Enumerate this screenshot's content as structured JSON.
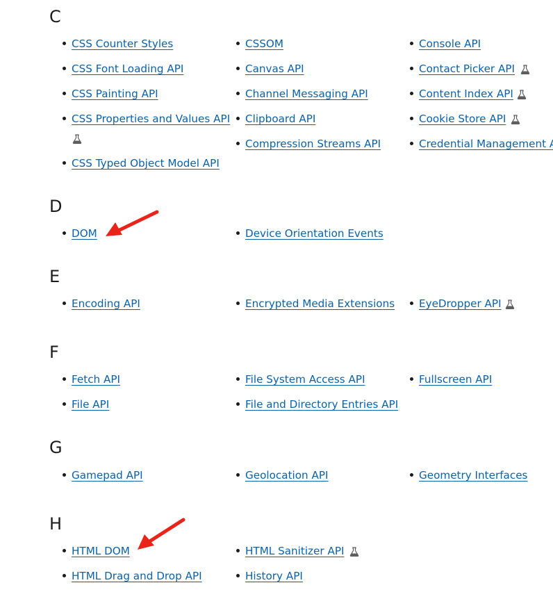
{
  "sections": [
    {
      "letter": "C",
      "items": [
        {
          "label": "CSS Counter Styles",
          "experimental": false
        },
        {
          "label": "CSS Font Loading API",
          "experimental": false
        },
        {
          "label": "CSS Painting API",
          "experimental": false
        },
        {
          "label": "CSS Properties and Values API",
          "experimental": true
        },
        {
          "label": "CSS Typed Object Model API",
          "experimental": false
        },
        {
          "label": "CSSOM",
          "experimental": false
        },
        {
          "label": "Canvas API",
          "experimental": false
        },
        {
          "label": "Channel Messaging API",
          "experimental": false
        },
        {
          "label": "Clipboard API",
          "experimental": false
        },
        {
          "label": "Compression Streams API",
          "experimental": false
        },
        {
          "label": "Console API",
          "experimental": false
        },
        {
          "label": "Contact Picker API",
          "experimental": true
        },
        {
          "label": "Content Index API",
          "experimental": true
        },
        {
          "label": "Cookie Store API",
          "experimental": true
        },
        {
          "label": "Credential Management API",
          "experimental": false
        }
      ]
    },
    {
      "letter": "D",
      "items": [
        {
          "label": "DOM",
          "experimental": false
        },
        {
          "label": "Device Orientation Events",
          "experimental": false
        }
      ]
    },
    {
      "letter": "E",
      "items": [
        {
          "label": "Encoding API",
          "experimental": false
        },
        {
          "label": "Encrypted Media Extensions",
          "experimental": false
        },
        {
          "label": "EyeDropper API",
          "experimental": true
        }
      ]
    },
    {
      "letter": "F",
      "items": [
        {
          "label": "Fetch API",
          "experimental": false
        },
        {
          "label": "File API",
          "experimental": false
        },
        {
          "label": "File System Access API",
          "experimental": false
        },
        {
          "label": "File and Directory Entries API",
          "experimental": false
        },
        {
          "label": "Fullscreen API",
          "experimental": false
        }
      ]
    },
    {
      "letter": "G",
      "items": [
        {
          "label": "Gamepad API",
          "experimental": false
        },
        {
          "label": "Geolocation API",
          "experimental": false
        },
        {
          "label": "Geometry Interfaces",
          "experimental": false
        }
      ]
    },
    {
      "letter": "H",
      "items": [
        {
          "label": "HTML DOM",
          "experimental": false
        },
        {
          "label": "HTML Drag and Drop API",
          "experimental": false
        },
        {
          "label": "HTML Sanitizer API",
          "experimental": true
        },
        {
          "label": "History API",
          "experimental": false
        }
      ]
    }
  ],
  "icons": {
    "experimental": "flask-icon",
    "annotation": "red-arrow-icon"
  },
  "colors": {
    "link": "#0b62a9",
    "text": "#1b1b1b",
    "flask": "#5e5e5e",
    "annotation_arrow": "#e8241b"
  }
}
